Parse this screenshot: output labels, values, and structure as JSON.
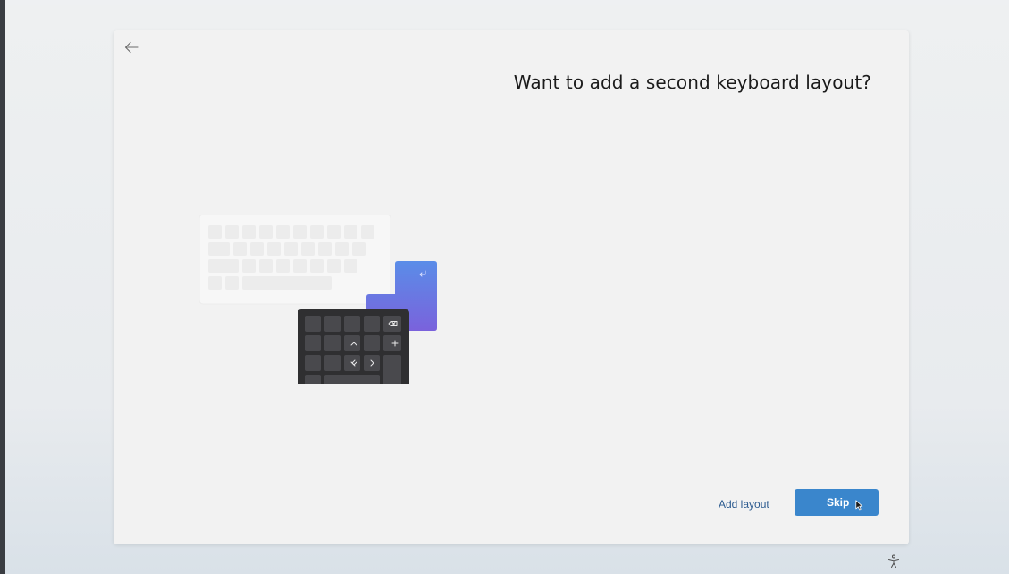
{
  "setup": {
    "title": "Want to add a second keyboard layout?",
    "add_layout_label": "Add layout",
    "skip_label": "Skip"
  },
  "icons": {
    "back": "back-arrow-icon",
    "illustration": "keyboard-illustration-icon",
    "cursor": "mouse-cursor-icon",
    "accessibility": "accessibility-icon"
  },
  "colors": {
    "primary_button": "#3a86cc",
    "link": "#2b5a8f",
    "enter_key": "#6a6fe0",
    "keypad": "#2f2f31"
  }
}
